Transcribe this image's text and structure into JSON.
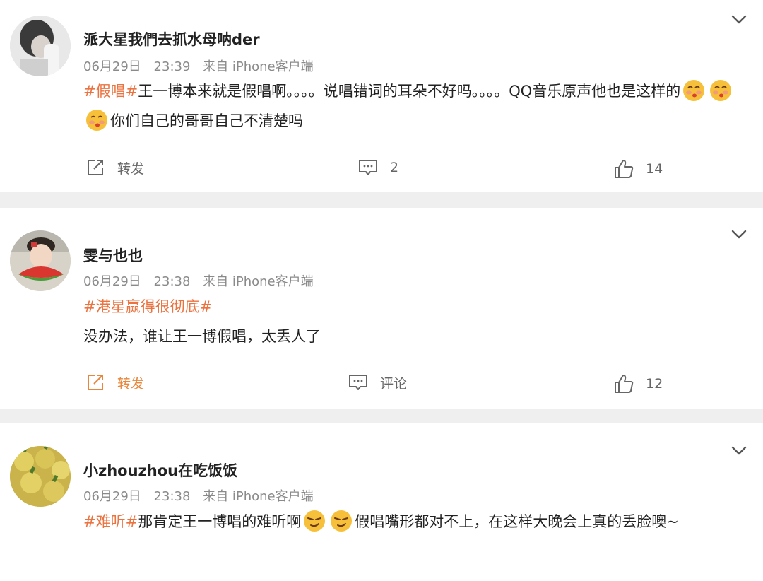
{
  "posts": [
    {
      "username": "派大星我們去抓水母呐der",
      "date": "06月29日",
      "time": "23:39",
      "source": "来自 iPhone客户端",
      "tag": "#假唱#",
      "text1": "王一博本来就是假唱啊。。。。说唱错词的耳朵不好吗。。。。QQ音乐原声他也是这样的",
      "text2": "你们自己的哥哥自己不清楚吗",
      "emoji": "kiss-face-icon",
      "repost_label": "转发",
      "comment_label": "2",
      "like_count": "14"
    },
    {
      "username": "雯与也也",
      "date": "06月29日",
      "time": "23:38",
      "source": "来自 iPhone客户端",
      "tag": "#港星赢得很彻底#",
      "text1": "没办法，谁让王一博假唱，太丢人了",
      "repost_label": "转发",
      "comment_label": "评论",
      "like_count": "12"
    },
    {
      "username": "小zhouzhou在吃饭饭",
      "date": "06月29日",
      "time": "23:38",
      "source": "来自 iPhone客户端",
      "tag": "#难听#",
      "text1": "那肯定王一博唱的难听啊",
      "text2": "假唱嘴形都对不上，在这样大晚会上真的丢脸噢~",
      "emoji": "smirk-face-icon"
    }
  ],
  "colors": {
    "tag": "#eb7340",
    "meta": "#8a8a8a",
    "separator": "#efefef",
    "highlight_action": "#e8873c"
  }
}
